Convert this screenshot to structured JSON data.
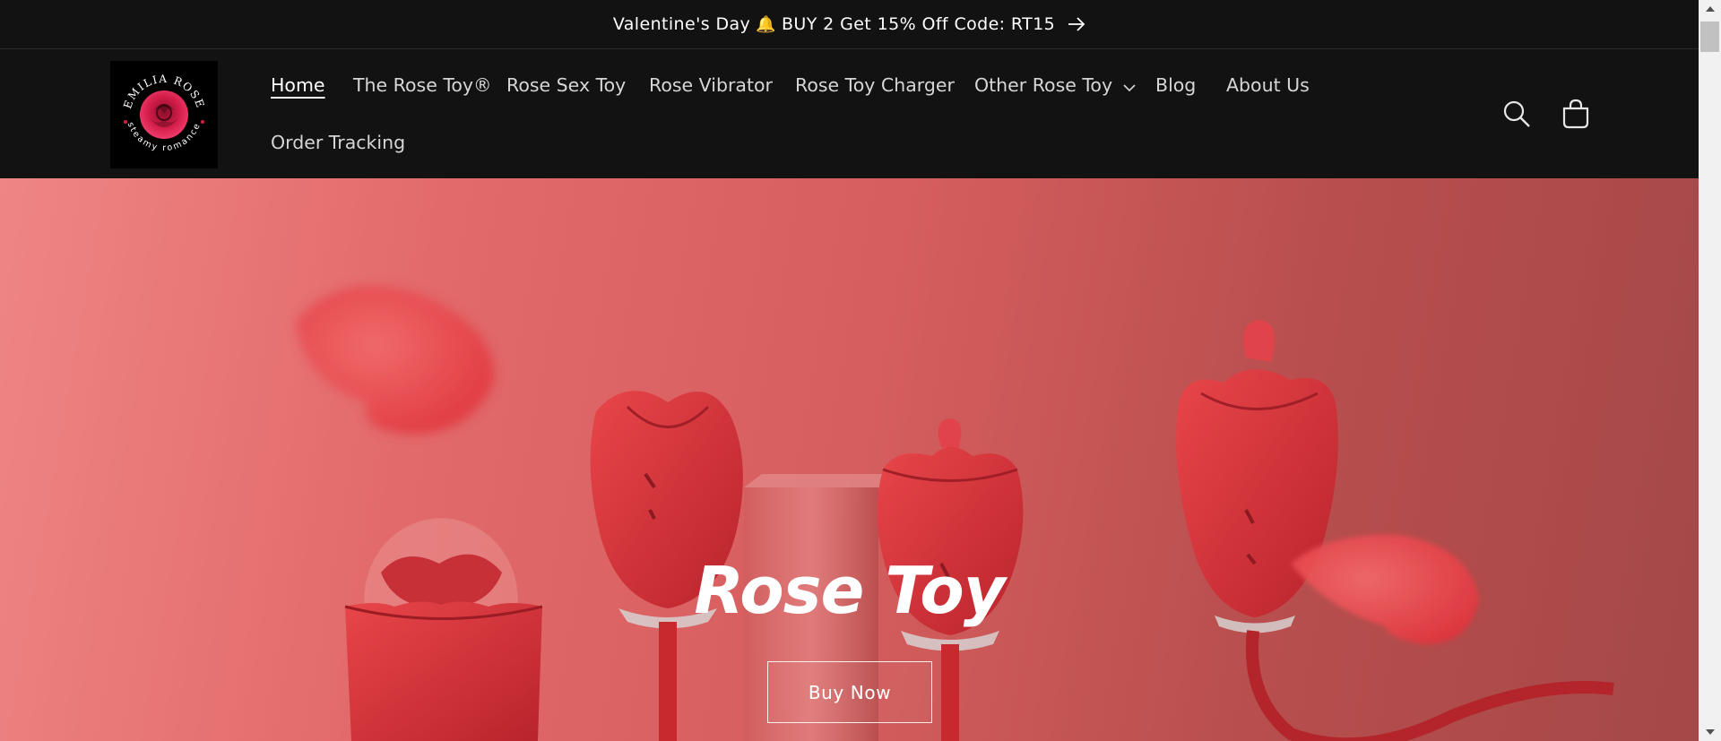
{
  "announcement": {
    "text_before": "Valentine's Day",
    "emoji": "🔔",
    "text_after": "BUY 2 Get 15% Off Code: RT15",
    "icon": "arrow-right-icon"
  },
  "header": {
    "logo": {
      "brand_top": "EMILIA ROSE",
      "brand_bottom": "steamy romance",
      "icon": "rose-logo"
    },
    "nav": [
      {
        "label": "Home",
        "active": true
      },
      {
        "label": "The Rose Toy®"
      },
      {
        "label": "Rose Sex Toy"
      },
      {
        "label": "Rose Vibrator"
      },
      {
        "label": "Rose Toy Charger"
      },
      {
        "label": "Other Rose Toy",
        "has_dropdown": true
      },
      {
        "label": "Blog"
      },
      {
        "label": "About Us"
      },
      {
        "label": "Order Tracking"
      }
    ],
    "icons": [
      "search-icon",
      "cart-icon"
    ]
  },
  "hero": {
    "title": "Rose Toy",
    "button_label": "Buy Now"
  },
  "colors": {
    "header_bg": "#121212",
    "hero_red": "#d65e5e",
    "rose_red": "#e0333d"
  }
}
